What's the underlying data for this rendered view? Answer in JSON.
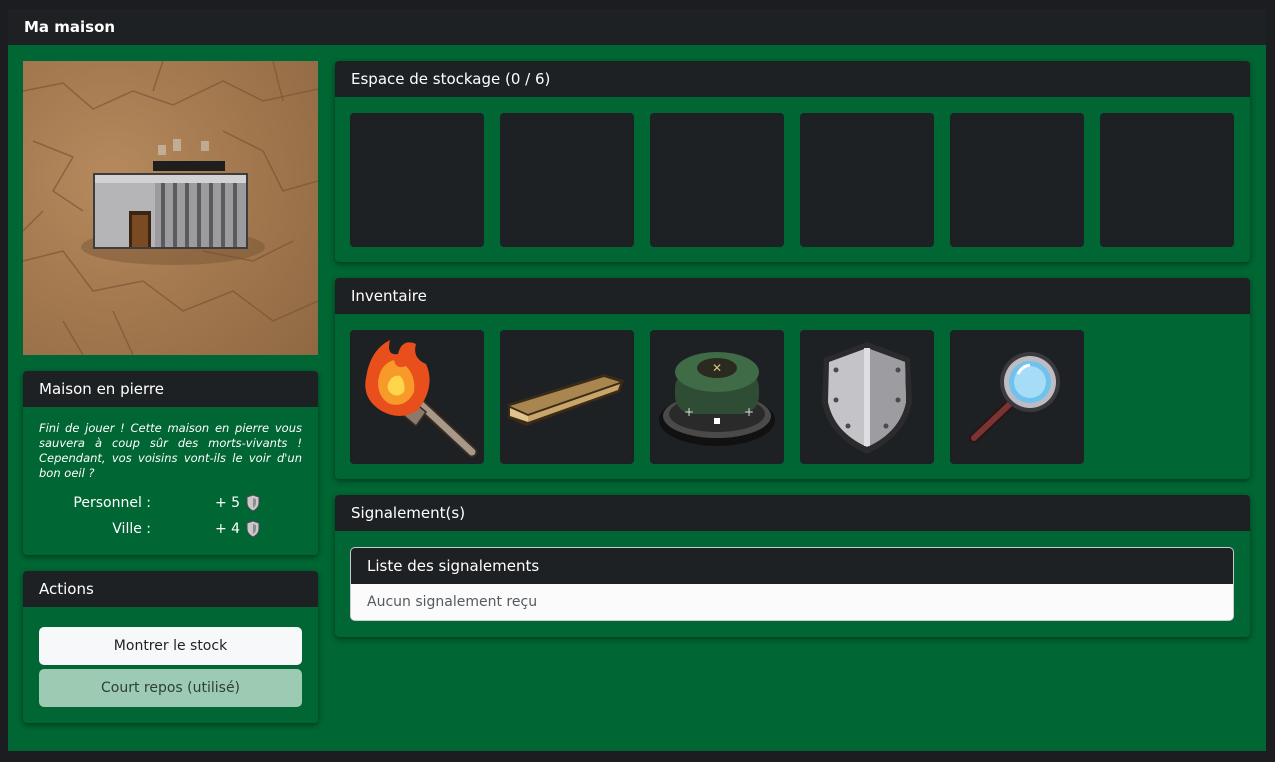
{
  "window": {
    "title": "Ma maison"
  },
  "house": {
    "name": "Maison en pierre",
    "description": "Fini de jouer ! Cette maison en pierre vous sauvera à coup sûr des morts-vivants ! Cependant, vos voisins vont-ils le voir d'un bon oeil ?",
    "stats": [
      {
        "label": "Personnel :",
        "value": "+ 5",
        "icon": "shield-icon"
      },
      {
        "label": "Ville :",
        "value": "+ 4",
        "icon": "shield-icon"
      }
    ]
  },
  "actions": {
    "title": "Actions",
    "show_stock_label": "Montrer le stock",
    "short_rest_label": "Court repos (utilisé)"
  },
  "storage": {
    "title": "Espace de stockage (0 / 6)",
    "slots": [
      null,
      null,
      null,
      null,
      null,
      null
    ]
  },
  "inventory": {
    "title": "Inventaire",
    "items": [
      "torch-icon",
      "wooden-plank-icon",
      "landmine-icon",
      "metal-shield-icon",
      "magnifying-glass-icon"
    ]
  },
  "reports": {
    "title": "Signalement(s)",
    "list_title": "Liste des signalements",
    "empty_text": "Aucun signalement reçu"
  },
  "colors": {
    "panel_green": "#006633",
    "header_dark": "#1e2124",
    "button_light": "#f7f8fa",
    "button_disabled": "#9ccab2"
  }
}
